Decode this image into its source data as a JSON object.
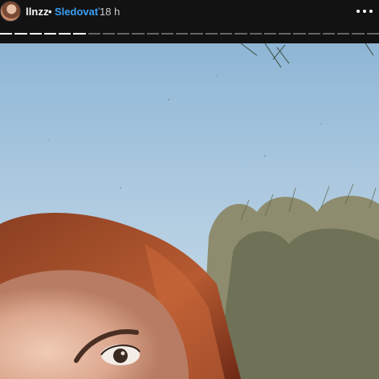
{
  "header": {
    "username": "llnzz",
    "separator": "•",
    "follow_label": "Sledovať",
    "time_ago": "18 h",
    "more_icon": "more-horizontal-icon"
  },
  "progress": {
    "total_segments": 26,
    "completed_segments": 6
  },
  "colors": {
    "header_bg": "#121212",
    "follow_accent": "#3aa0f5",
    "sky": "#a9c8e0"
  }
}
